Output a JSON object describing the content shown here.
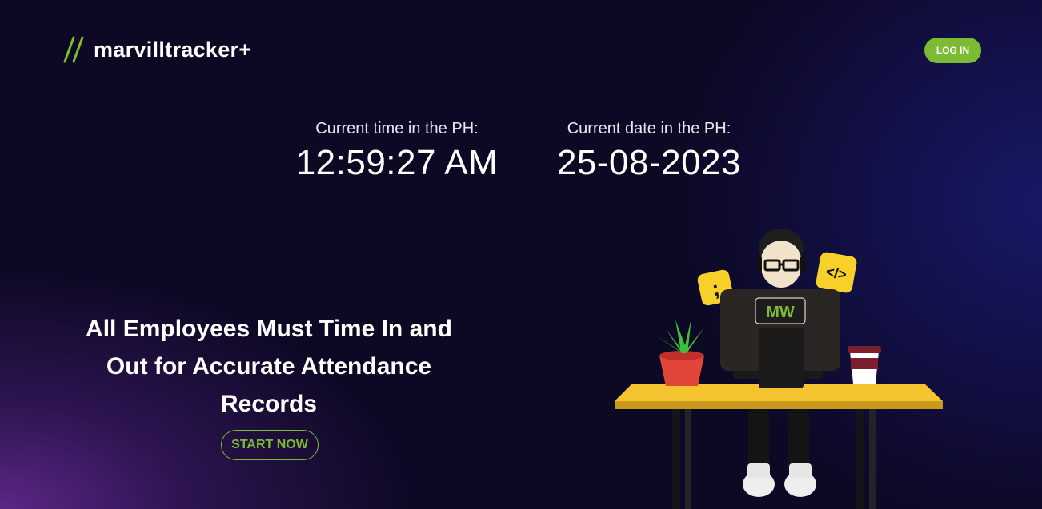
{
  "header": {
    "logo_text": "marvilltracker+",
    "login_label": "LOG IN"
  },
  "clock": {
    "time_label": "Current time in the PH:",
    "time_value": "12:59:27 AM",
    "date_label": "Current date in the PH:",
    "date_value": "25-08-2023"
  },
  "hero": {
    "headline": "All Employees Must Time In and Out for Accurate Attendance Records",
    "cta_label": "START NOW"
  },
  "illustration": {
    "monitor_logo": "MW",
    "code_badge": "</>",
    "semicolon_badge": ";"
  },
  "colors": {
    "accent": "#7dbb34",
    "background": "#0d0824",
    "desk": "#f4c430"
  }
}
